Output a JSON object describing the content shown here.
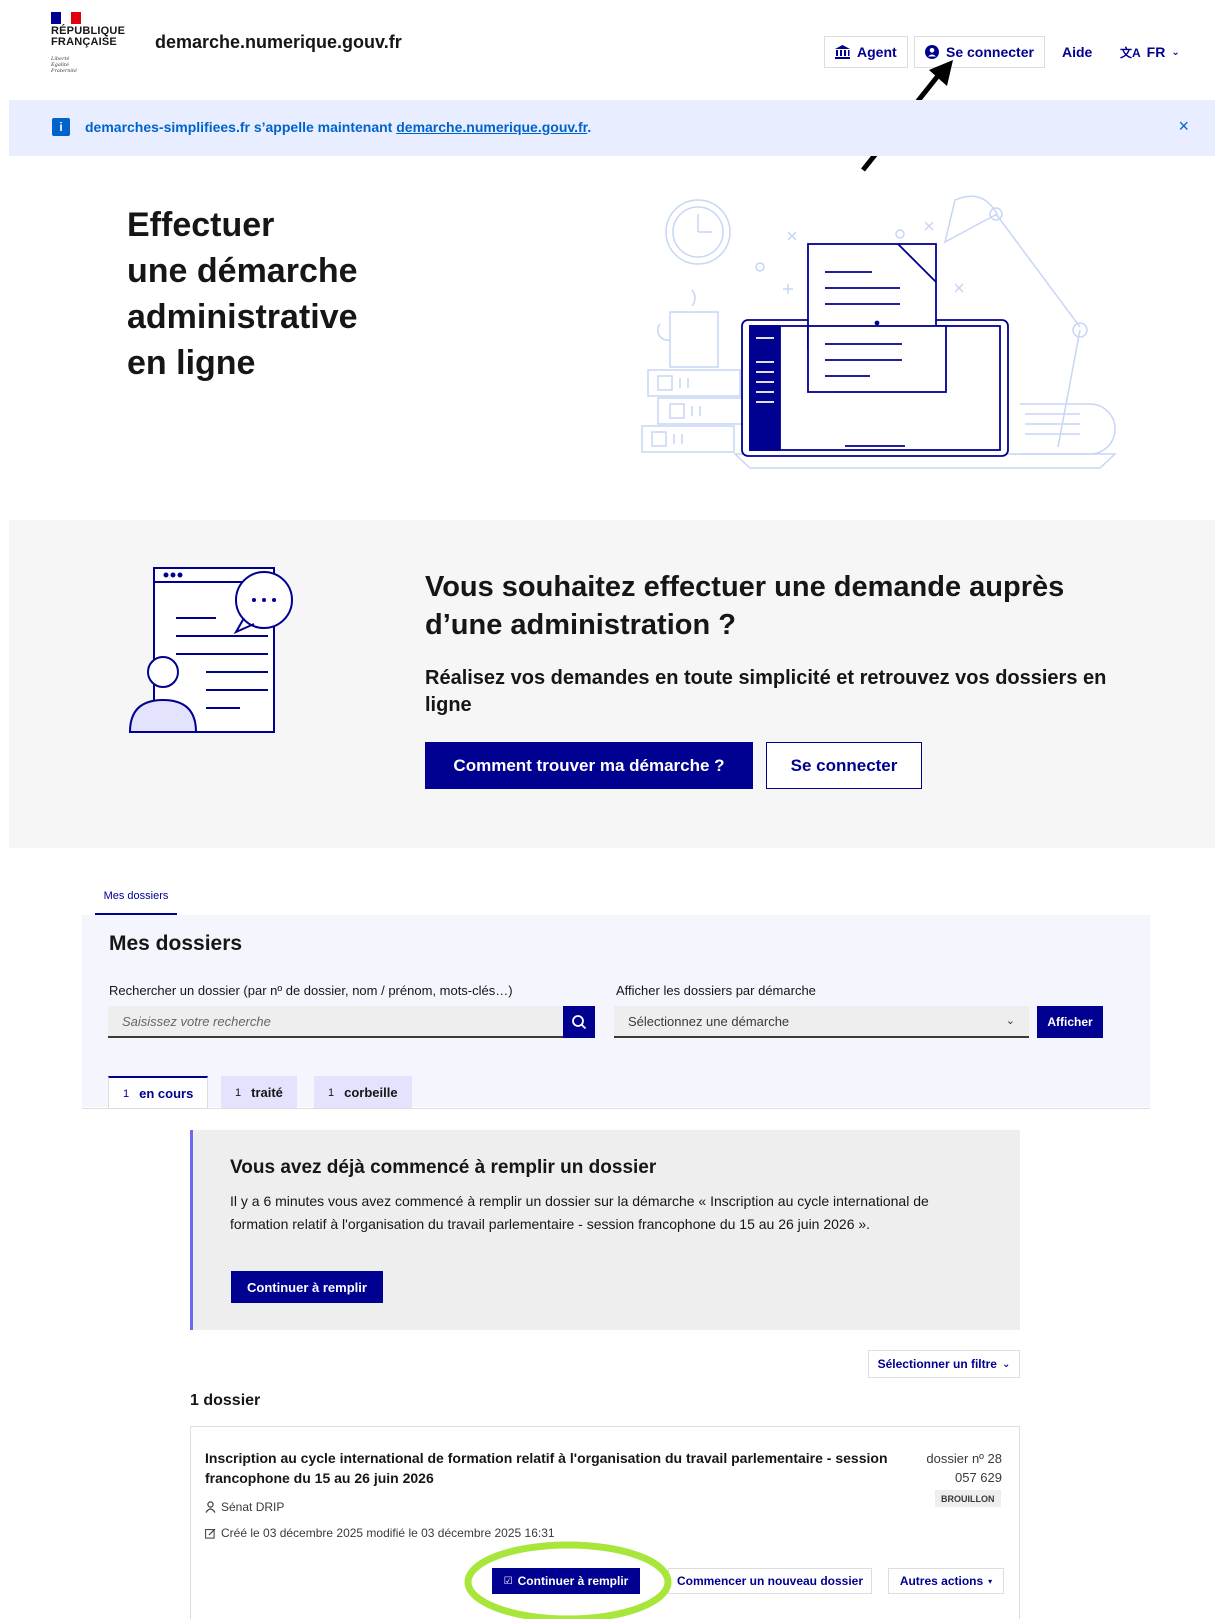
{
  "header": {
    "logo_lines": [
      "RÉPUBLIQUE",
      "FRANÇAISE"
    ],
    "motto_lines": [
      "Liberté",
      "Égalité",
      "Fraternité"
    ],
    "site_name": "demarche.numerique.gouv.fr",
    "agent_label": "Agent",
    "connect_label": "Se connecter",
    "help_label": "Aide",
    "lang_label": "FR"
  },
  "notice": {
    "icon": "i",
    "text_before": "demarches-simplifiees.fr s’appelle maintenant ",
    "link": "demarche.numerique.gouv.fr",
    "text_after": ".",
    "close": "×"
  },
  "hero": {
    "title_lines": [
      "Effectuer",
      "une démarche",
      "administrative",
      "en ligne"
    ]
  },
  "promo": {
    "title": "Vous souhaitez effectuer une demande auprès d’une administration ?",
    "subtitle": "Réalisez vos demandes en toute simplicité et retrouvez vos dossiers en ligne",
    "primary_button": "Comment trouver ma démarche ?",
    "secondary_button": "Se connecter"
  },
  "dossiers": {
    "tab_label": "Mes dossiers",
    "heading": "Mes dossiers",
    "search_label": "Rechercher un dossier (par nº de dossier, nom / prénom, mots-clés…)",
    "search_placeholder": "Saisissez votre recherche",
    "filter_label": "Afficher les dossiers par démarche",
    "select_value": "Sélectionnez une démarche",
    "show_button": "Afficher",
    "tabs": [
      {
        "count": "1",
        "label": "en cours"
      },
      {
        "count": "1",
        "label": "traité"
      },
      {
        "count": "1",
        "label": "corbeille"
      }
    ]
  },
  "callout": {
    "title": "Vous avez déjà commencé à remplir un dossier",
    "text": "Il y a 6 minutes vous avez commencé à remplir un dossier sur la démarche « Inscription au cycle international de formation relatif à l'organisation du travail parlementaire - session francophone du 15 au 26 juin 2026 ».",
    "button": "Continuer à remplir"
  },
  "list": {
    "filter_button": "Sélectionner un filtre",
    "count": "1 dossier"
  },
  "card": {
    "title": "Inscription au cycle international de formation relatif à l'organisation du travail parlementaire - session francophone du 15 au 26 juin 2026",
    "number_line1": "dossier nº 28",
    "number_line2": "057 629",
    "status": "BROUILLON",
    "org": "Sénat DRIP",
    "dates": "Créé le 03 décembre 2025 modifié le 03 décembre 2025 16:31",
    "continue_button": "Continuer à remplir",
    "new_button": "Commencer un nouveau dossier",
    "actions_button": "Autres actions"
  },
  "colors": {
    "primary": "#000091",
    "info": "#0063cb",
    "highlight": "#a8e63c"
  }
}
